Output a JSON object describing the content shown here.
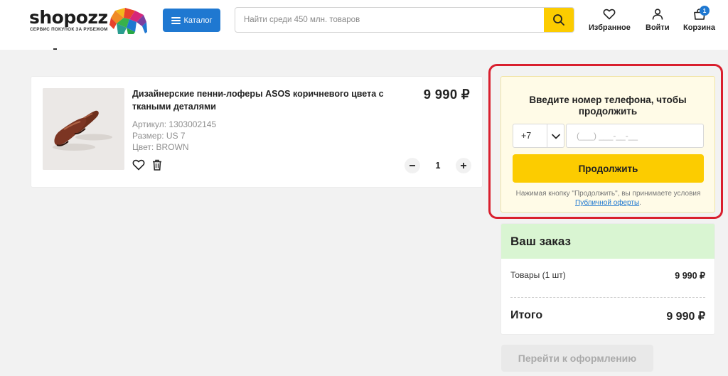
{
  "header": {
    "logo_text": "shopozz",
    "logo_subtitle": "СЕРВИС ПОКУПОК ЗА РУБЕЖОМ",
    "catalog_label": "Каталог",
    "search_placeholder": "Найти среди 450 млн. товаров",
    "favorites_label": "Избранное",
    "login_label": "Войти",
    "cart_label": "Корзина",
    "cart_count": "1"
  },
  "product": {
    "title": "Дизайнерские пенни-лоферы ASOS коричневого цвета с ткаными деталями",
    "price": "9 990 ₽",
    "article": "Артикул: 1303002145",
    "size": "Размер: US 7",
    "color": "Цвет: BROWN",
    "quantity": "1"
  },
  "phone_form": {
    "title": "Введите номер телефона, чтобы продолжить",
    "country_code": "+7",
    "phone_placeholder": "(___) ___-__-__",
    "continue_label": "Продолжить",
    "terms_text": "Нажимая кнопку \"Продолжить\", вы принимаете условия",
    "terms_link": "Публичной оферты",
    "terms_end": "."
  },
  "order": {
    "title": "Ваш заказ",
    "items_label": "Товары (1 шт)",
    "items_value": "9 990 ₽",
    "total_label": "Итого",
    "total_value": "9 990 ₽",
    "checkout_label": "Перейти к оформлению"
  },
  "colors": {
    "accent_blue": "#1f78d1",
    "accent_yellow": "#fccc00",
    "highlight_red": "#d91f2e",
    "order_header_green": "#d9f5d2"
  }
}
